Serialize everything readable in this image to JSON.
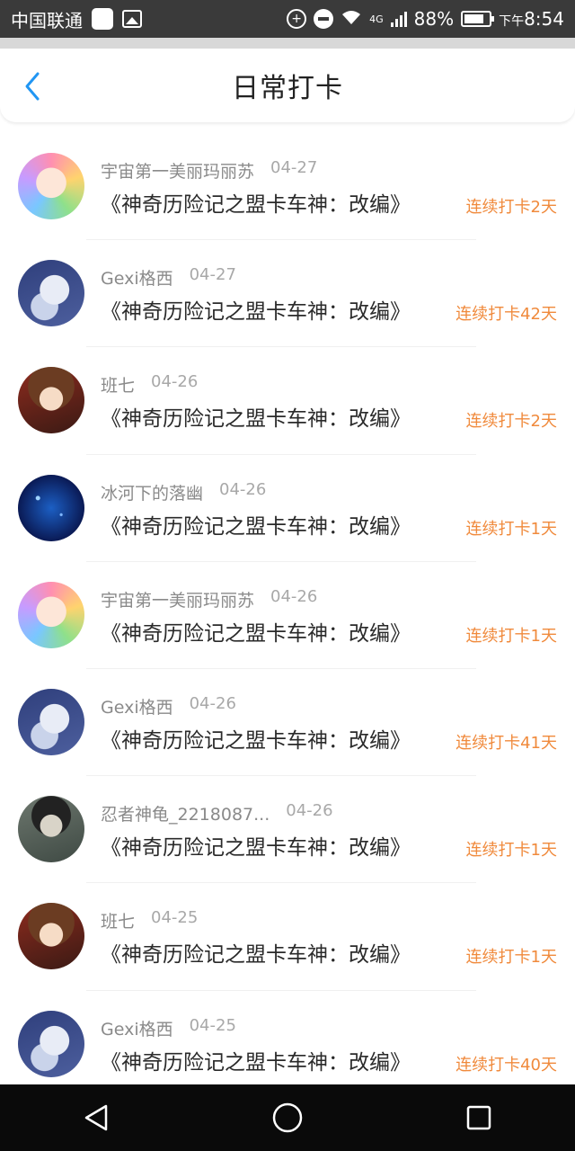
{
  "status_bar": {
    "carrier": "中国联通",
    "battery": "88%",
    "network": "4G",
    "time_prefix": "下午",
    "time": "8:54"
  },
  "header": {
    "title": "日常打卡"
  },
  "items": [
    {
      "name": "宇宙第一美丽玛丽苏",
      "date": "04-27",
      "title": "《神奇历险记之盟卡车神：改编》",
      "streak": "连续打卡2天",
      "avatar": "rainbow"
    },
    {
      "name": "Gexi格西",
      "date": "04-27",
      "title": "《神奇历险记之盟卡车神：改编》",
      "streak": "连续打卡42天",
      "avatar": "blue"
    },
    {
      "name": "班七",
      "date": "04-26",
      "title": "《神奇历险记之盟卡车神：改编》",
      "streak": "连续打卡2天",
      "avatar": "warm"
    },
    {
      "name": "冰河下的落幽",
      "date": "04-26",
      "title": "《神奇历险记之盟卡车神：改编》",
      "streak": "连续打卡1天",
      "avatar": "galaxy"
    },
    {
      "name": "宇宙第一美丽玛丽苏",
      "date": "04-26",
      "title": "《神奇历险记之盟卡车神：改编》",
      "streak": "连续打卡1天",
      "avatar": "rainbow"
    },
    {
      "name": "Gexi格西",
      "date": "04-26",
      "title": "《神奇历险记之盟卡车神：改编》",
      "streak": "连续打卡41天",
      "avatar": "blue"
    },
    {
      "name": "忍者神龟_2218087...",
      "date": "04-26",
      "title": "《神奇历险记之盟卡车神：改编》",
      "streak": "连续打卡1天",
      "avatar": "dark"
    },
    {
      "name": "班七",
      "date": "04-25",
      "title": "《神奇历险记之盟卡车神：改编》",
      "streak": "连续打卡1天",
      "avatar": "warm"
    },
    {
      "name": "Gexi格西",
      "date": "04-25",
      "title": "《神奇历险记之盟卡车神：改编》",
      "streak": "连续打卡40天",
      "avatar": "blue"
    }
  ],
  "colors": {
    "accent": "#2196f3",
    "streak": "#f08a3c"
  }
}
